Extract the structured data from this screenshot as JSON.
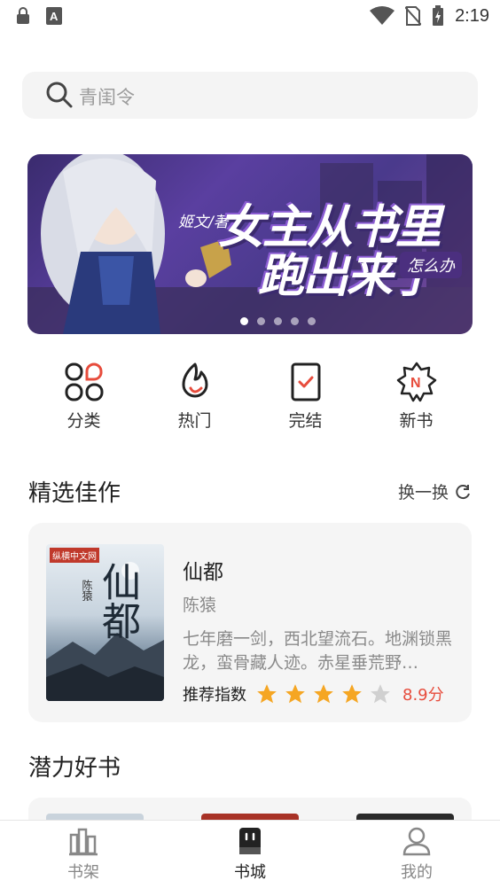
{
  "status_bar": {
    "time": "2:19",
    "left_icons": [
      "lock-icon",
      "a-font-icon"
    ],
    "right_icons": [
      "wifi-icon",
      "no-sim-icon",
      "battery-charging-icon"
    ]
  },
  "search": {
    "placeholder": "青闺令"
  },
  "banner": {
    "author": "姬文/著",
    "title_line1": "女主从书里",
    "title_line2": "跑出来了",
    "tag": "怎么办",
    "dots_count": 5,
    "active_dot": 0
  },
  "quick_nav": [
    {
      "label": "分类",
      "icon": "category-icon"
    },
    {
      "label": "热门",
      "icon": "flame-icon"
    },
    {
      "label": "完结",
      "icon": "completed-icon"
    },
    {
      "label": "新书",
      "icon": "new-badge-icon"
    }
  ],
  "featured": {
    "title": "精选佳作",
    "refresh_label": "换一换",
    "book": {
      "cover_publisher": "纵横中文网",
      "cover_title": "仙都",
      "cover_author": "陈猿",
      "title": "仙都",
      "author": "陈猿",
      "description": "七年磨一剑，西北望流石。地渊锁黑龙，蛮骨藏人迹。赤星垂荒野…",
      "rating_label": "推荐指数",
      "stars": 4,
      "stars_max": 5,
      "score": "8.9分"
    }
  },
  "potential": {
    "title": "潜力好书"
  },
  "tabbar": [
    {
      "label": "书架",
      "icon": "bookshelf-icon",
      "active": false
    },
    {
      "label": "书城",
      "icon": "bookstore-icon",
      "active": true
    },
    {
      "label": "我的",
      "icon": "profile-icon",
      "active": false
    }
  ],
  "colors": {
    "accent_red": "#e74c3c",
    "star": "#f5a623",
    "star_empty": "#d0d0d0"
  }
}
